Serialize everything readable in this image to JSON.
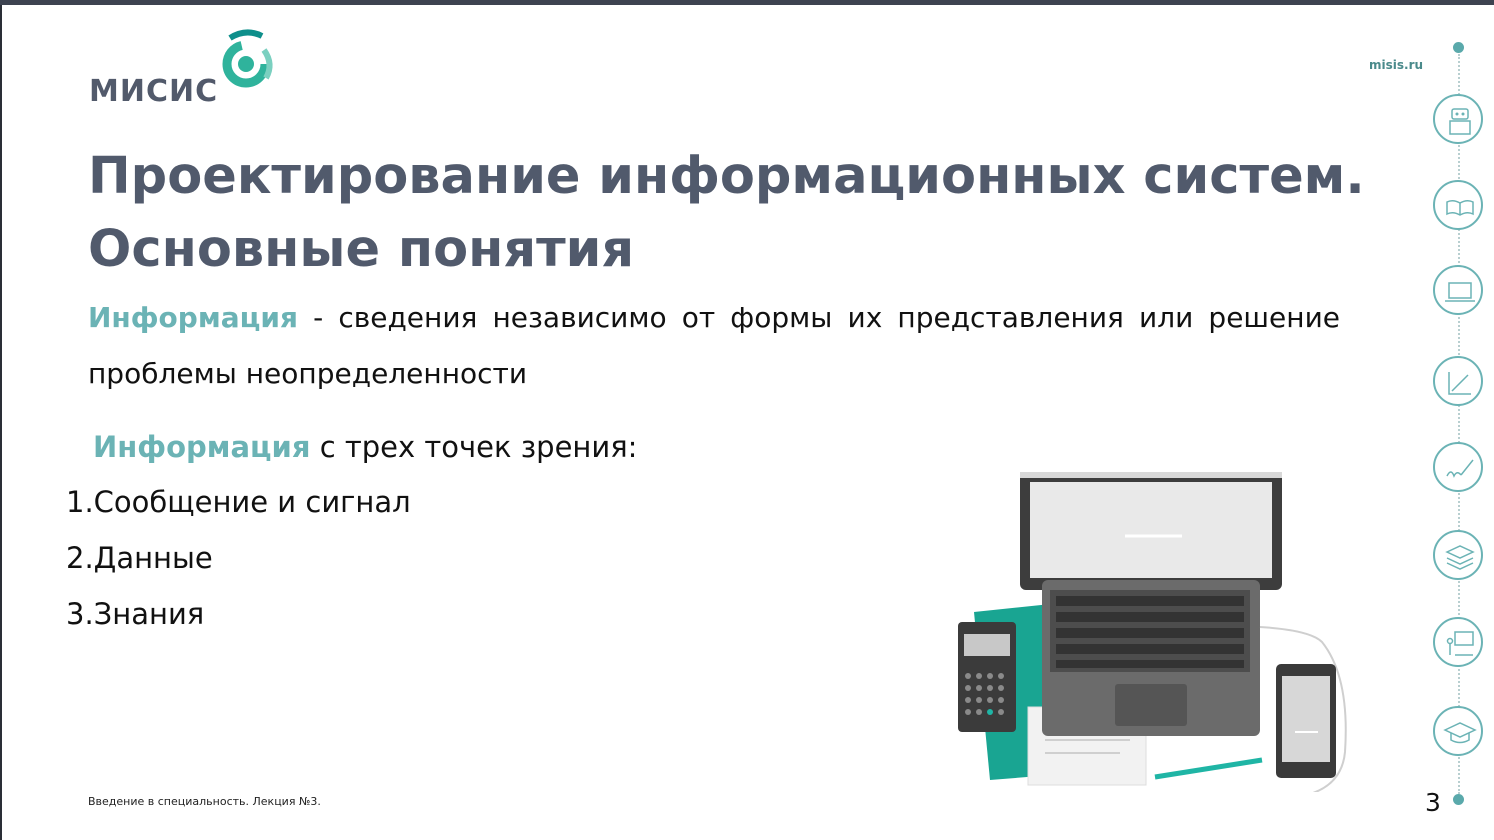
{
  "logo": {
    "text": "МИСИС"
  },
  "header": {
    "site": "misis.ru"
  },
  "title": {
    "line1": "Проектирование информационных систем.",
    "line2": "Основные понятия"
  },
  "definition": {
    "term": "Информация",
    "text": " - сведения независимо от формы их представления или решение проблемы неопределенности"
  },
  "viewpoints": {
    "term": "Информация",
    "text": " с трех точек зрения:",
    "items": [
      "1.Сообщение и сигнал",
      "2.Данные",
      "3.Знания"
    ]
  },
  "footer": {
    "text": "Введение в специальность. Лекция №3.",
    "page": "3"
  },
  "sidebar": {
    "icons": [
      "robot-icon",
      "book-icon",
      "laptop-icon",
      "chart-icon",
      "signature-icon",
      "stack-icon",
      "teacher-icon",
      "graduation-cap-icon"
    ]
  },
  "colors": {
    "accent": "#6bb3b5",
    "title": "#515a6c",
    "logo_teal": "#2fb39c"
  }
}
